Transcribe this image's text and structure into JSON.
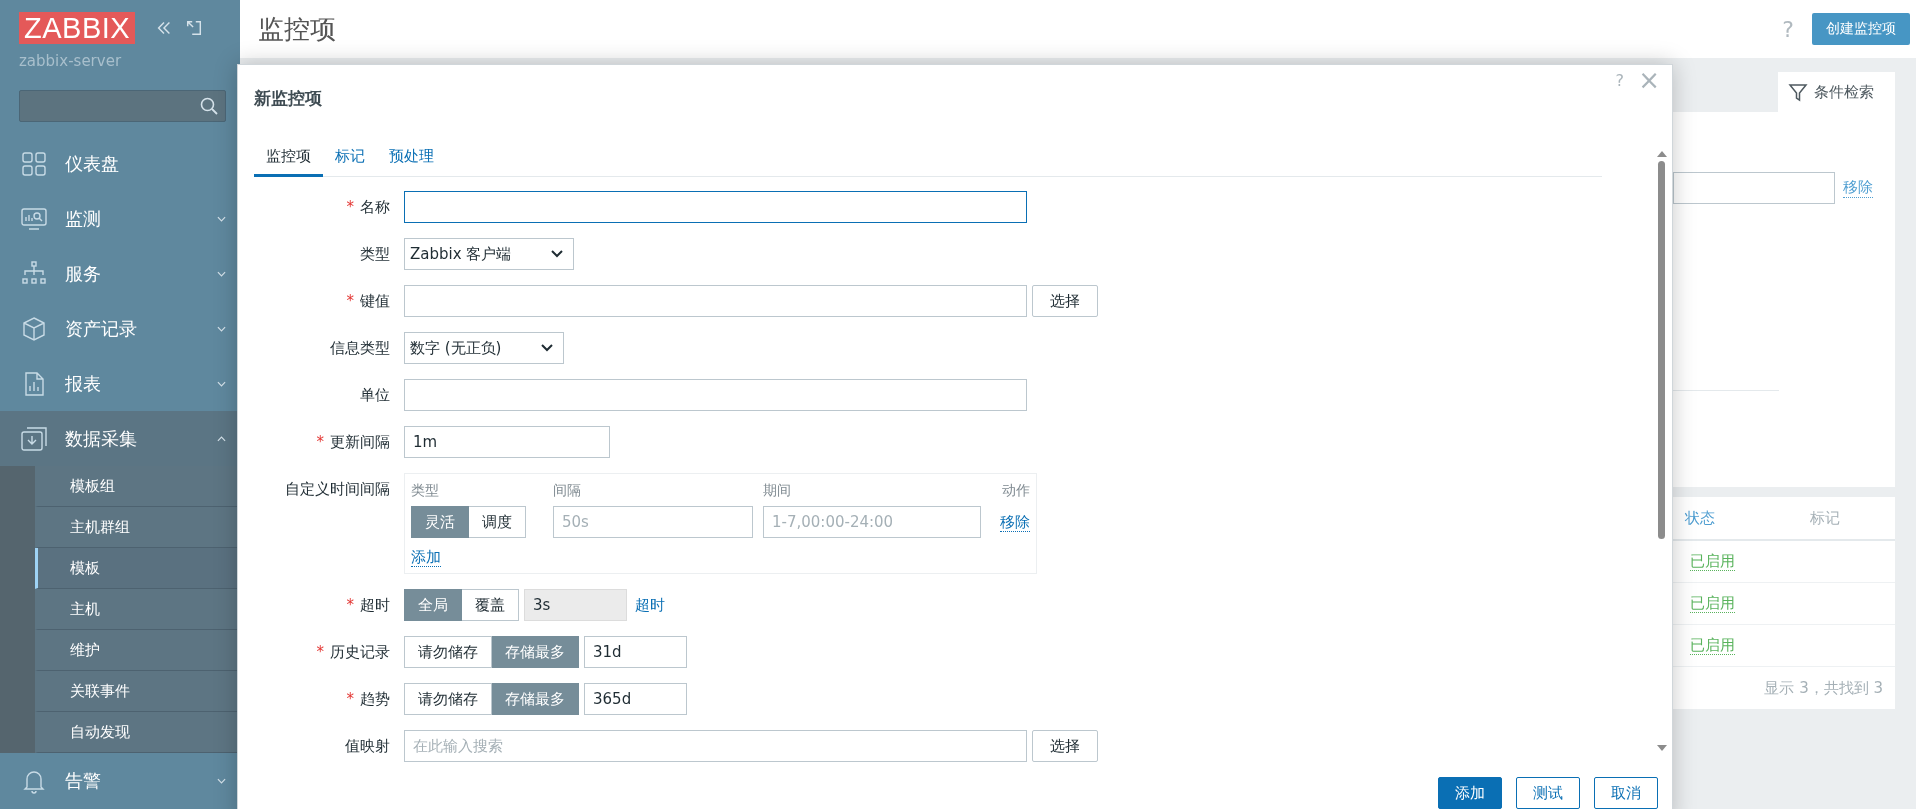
{
  "sidebar": {
    "logo": "ZABBIX",
    "server": "zabbix-server",
    "menu": [
      {
        "label": "仪表盘",
        "kind": "link"
      },
      {
        "label": "监测",
        "kind": "group",
        "expanded": false
      },
      {
        "label": "服务",
        "kind": "group",
        "expanded": false
      },
      {
        "label": "资产记录",
        "kind": "group",
        "expanded": false
      },
      {
        "label": "报表",
        "kind": "group",
        "expanded": false
      },
      {
        "label": "数据采集",
        "kind": "group",
        "expanded": true,
        "children": [
          {
            "label": "模板组",
            "selected": false
          },
          {
            "label": "主机群组",
            "selected": false
          },
          {
            "label": "模板",
            "selected": true
          },
          {
            "label": "主机",
            "selected": false
          },
          {
            "label": "维护",
            "selected": false
          },
          {
            "label": "关联事件",
            "selected": false
          },
          {
            "label": "自动发现",
            "selected": false
          }
        ]
      },
      {
        "label": "告警",
        "kind": "group",
        "expanded": false
      }
    ]
  },
  "page": {
    "title": "监控项",
    "help": "?",
    "create_button": "创建监控项"
  },
  "background": {
    "filter_tab": "条件检索",
    "remove_link": "移除",
    "columns": [
      "状态",
      "标记"
    ],
    "rows": [
      {
        "status": "已启用"
      },
      {
        "status": "已启用"
      },
      {
        "status": "已启用"
      }
    ],
    "footer": "显示 3，共找到 3"
  },
  "dialog": {
    "title": "新监控项",
    "help": "?",
    "close": "×",
    "required_mark": "*",
    "tabs": [
      {
        "label": "监控项",
        "selected": true
      },
      {
        "label": "标记",
        "selected": false
      },
      {
        "label": "预处理",
        "selected": false
      }
    ],
    "fields": [
      {
        "kind": "text",
        "label": "名称",
        "required": true,
        "focused": true
      },
      {
        "kind": "select",
        "label": "类型",
        "required": false,
        "value": "Zabbix 客户端"
      },
      {
        "kind": "text",
        "label": "键值",
        "required": true,
        "focused": false,
        "button": "选择"
      },
      {
        "kind": "select",
        "label": "信息类型",
        "required": false,
        "value": "数字 (无正负)"
      },
      {
        "kind": "text",
        "label": "单位",
        "required": false,
        "focused": false
      },
      {
        "kind": "short",
        "label": "更新间隔",
        "required": true,
        "value": "1m"
      },
      {
        "kind": "intervals",
        "label": "自定义时间间隔",
        "required": false,
        "columns": [
          "类型",
          "间隔",
          "期间",
          "动作"
        ],
        "rows": [
          {
            "options": [
              {
                "label": "灵活",
                "selected": true
              },
              {
                "label": "调度",
                "selected": false
              }
            ],
            "interval_placeholder": "50s",
            "period_placeholder": "1-7,00:00-24:00",
            "action": "移除"
          }
        ],
        "add": "添加"
      },
      {
        "kind": "segmented",
        "label": "超时",
        "required": true,
        "options": [
          {
            "label": "全局",
            "selected": true
          },
          {
            "label": "覆盖",
            "selected": false
          }
        ],
        "value": "3s",
        "disabled": true,
        "link": "超时"
      },
      {
        "kind": "segmented",
        "label": "历史记录",
        "required": true,
        "options": [
          {
            "label": "请勿储存",
            "selected": false
          },
          {
            "label": "存储最多",
            "selected": true
          }
        ],
        "value": "31d",
        "disabled": false
      },
      {
        "kind": "segmented",
        "label": "趋势",
        "required": true,
        "options": [
          {
            "label": "请勿储存",
            "selected": false
          },
          {
            "label": "存储最多",
            "selected": true
          }
        ],
        "value": "365d",
        "disabled": false
      },
      {
        "kind": "text",
        "label": "值映射",
        "required": false,
        "focused": false,
        "placeholder": "在此输入搜索",
        "button": "选择"
      }
    ],
    "buttons": [
      {
        "label": "添加",
        "kind": "primary"
      },
      {
        "label": "测试",
        "kind": "secondary"
      },
      {
        "label": "取消",
        "kind": "secondary"
      }
    ]
  }
}
